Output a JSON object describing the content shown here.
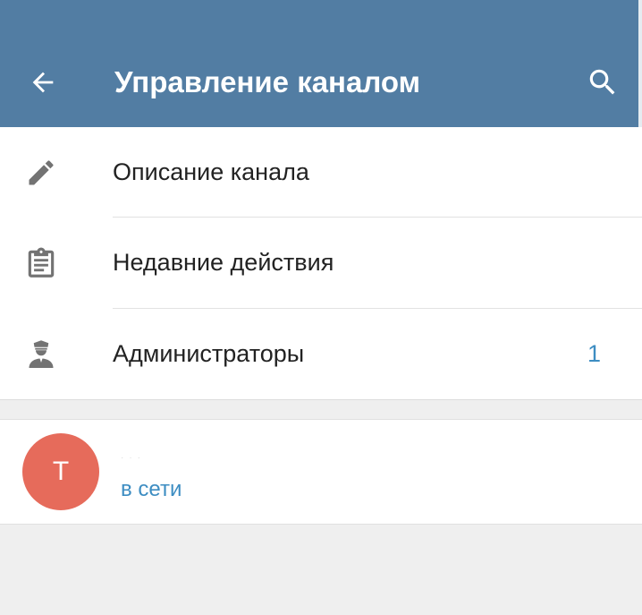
{
  "header": {
    "title": "Управление каналом",
    "background_color": "#527da3",
    "back_icon": "arrow-left-icon",
    "search_icon": "search-icon"
  },
  "menu": {
    "items": [
      {
        "label": "Описание канала",
        "icon": "pencil-icon"
      },
      {
        "label": "Недавние действия",
        "icon": "clipboard-icon"
      },
      {
        "label": "Администраторы",
        "icon": "admin-icon",
        "count": "1"
      }
    ],
    "count_color": "#3d8dc2"
  },
  "user": {
    "avatar_letter": "T",
    "avatar_color": "#e66b5b",
    "status": "в сети"
  }
}
